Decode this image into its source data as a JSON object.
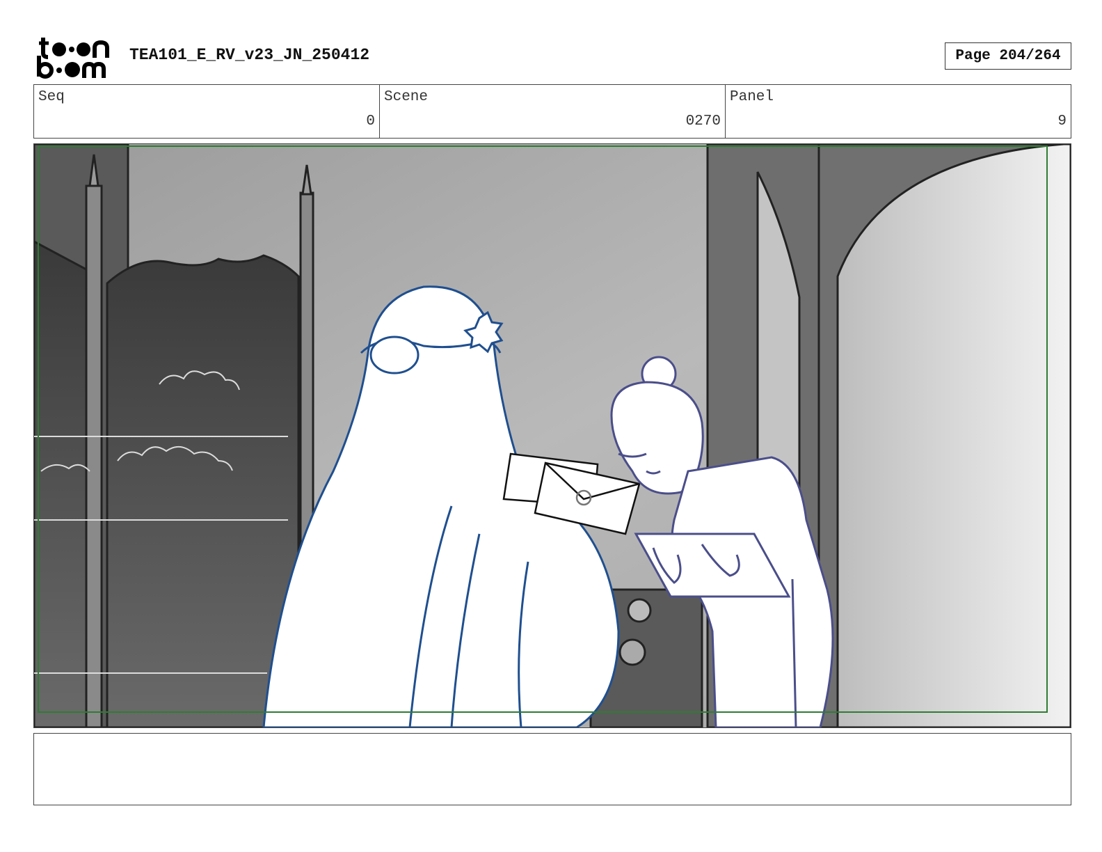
{
  "header": {
    "logo_alt": "toon boom",
    "title": "TEA101_E_RV_v23_JN_250412",
    "page": "Page 204/264"
  },
  "info": {
    "seq_label": "Seq",
    "seq_value": "0",
    "scene_label": "Scene",
    "scene_value": "0270",
    "panel_label": "Panel",
    "panel_value": "9"
  },
  "colors": {
    "safe_frame": "#2e7d32",
    "character_line": "#1f4f8f",
    "servant_line": "#4b4e8a"
  },
  "notes": {
    "text": ""
  }
}
